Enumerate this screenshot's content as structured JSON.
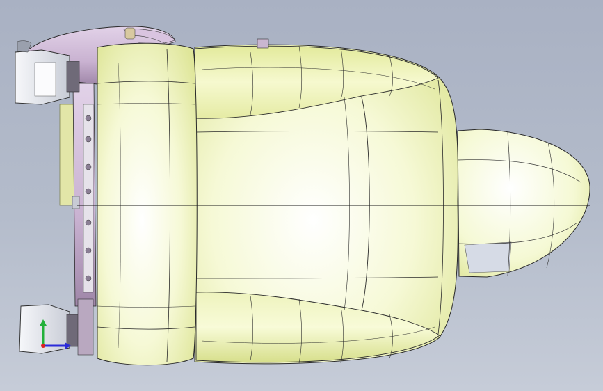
{
  "viewport": {
    "background_top": "#a9b1c3",
    "background_bottom": "#c6ccd8",
    "model": "car-seat-top-view"
  },
  "colors": {
    "cushion": "#f4f8c8",
    "cushion_shade": "#dfe69a",
    "cushion_edge": "#2a2a2a",
    "frame": "#c9b6d0",
    "frame_shade": "#a98fb2",
    "bracket": "#e4e6ec",
    "mechanism": "#6f6a78",
    "plate": "#e2e6a8",
    "headrest_grey": "#d6dbe6"
  },
  "triad": {
    "x_color": "#2b2bd9",
    "y_color": "#22b03a",
    "z_color": "#d92222",
    "icon": "view-orientation-triad"
  }
}
